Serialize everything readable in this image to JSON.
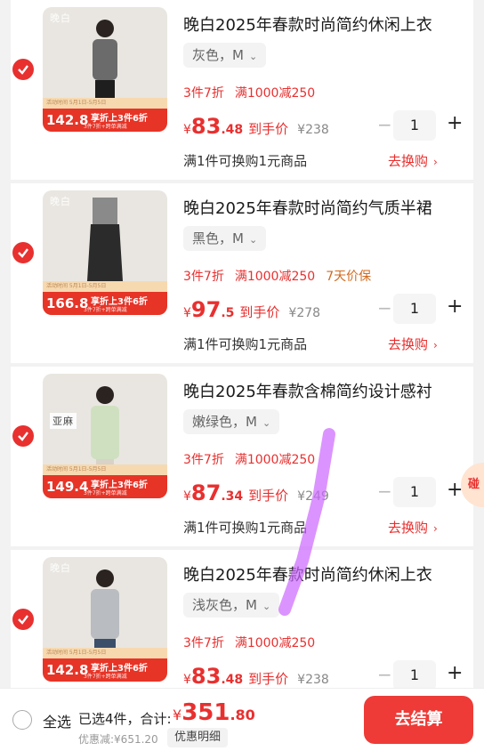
{
  "items": [
    {
      "title": "晚白2025年春款时尚简约休闲上衣",
      "sku": "灰色，M",
      "promos": [
        "3件7折",
        "满1000减250"
      ],
      "price_currency": "¥",
      "price_int": "83",
      "price_dec": ".48",
      "price_label": "到手价",
      "orig_price": "¥238",
      "quantity": "1",
      "exchange_text": "满1件可换购1元商品",
      "exchange_link": "去换购",
      "thumb_brand": "晚白",
      "thumb_price": "142.8",
      "thumb_tag": "享折上3件6折",
      "thumb_sub": "活动时间 5月1日-5月5日",
      "thumb_fine": "3件7折+跨单满减",
      "shirt_color": "#6b6b6b"
    },
    {
      "title": "晚白2025年春款时尚简约气质半裙",
      "sku": "黑色，M",
      "promos": [
        "3件7折",
        "满1000减250",
        "7天价保"
      ],
      "price_currency": "¥",
      "price_int": "97",
      "price_dec": ".5",
      "price_label": "到手价",
      "orig_price": "¥278",
      "quantity": "1",
      "exchange_text": "满1件可换购1元商品",
      "exchange_link": "去换购",
      "thumb_brand": "晚白",
      "thumb_price": "166.8",
      "thumb_tag": "享折上3件6折",
      "thumb_sub": "活动时间 5月1日-5月5日",
      "thumb_fine": "3件7折+跨单满减",
      "shirt_color": "#2b2b2b"
    },
    {
      "title": "晚白2025年春款含棉简约设计感衬",
      "sku": "嫩绿色，M",
      "promos": [
        "3件7折",
        "满1000减250"
      ],
      "price_currency": "¥",
      "price_int": "87",
      "price_dec": ".34",
      "price_label": "到手价",
      "orig_price": "¥249",
      "quantity": "1",
      "exchange_text": "满1件可换购1元商品",
      "exchange_link": "去换购",
      "thumb_brand": "亚麻",
      "thumb_price": "149.4",
      "thumb_tag": "享折上3件6折",
      "thumb_sub": "活动时间 5月1日-5月5日",
      "thumb_fine": "3件7折+跨单满减",
      "shirt_color": "#cfe0c0"
    },
    {
      "title": "晚白2025年春款时尚简约休闲上衣",
      "sku": "浅灰色，M",
      "promos": [
        "3件7折",
        "满1000减250"
      ],
      "price_currency": "¥",
      "price_int": "83",
      "price_dec": ".48",
      "price_label": "到手价",
      "orig_price": "¥238",
      "quantity": "1",
      "thumb_brand": "晚白",
      "thumb_price": "142.8",
      "thumb_tag": "享折上3件6折",
      "thumb_sub": "活动时间 5月1日-5月5日",
      "thumb_fine": "3件7折+跨单满减",
      "shirt_color": "#b9bcc0"
    }
  ],
  "footer": {
    "select_all": "全选",
    "selected_text": "已选4件，合计:",
    "total_currency": "¥",
    "total_int": "351",
    "total_dec": ".80",
    "discount_text": "优惠减:¥651.20",
    "detail_button": "优惠明细",
    "checkout_button": "去结算"
  },
  "floating_badge": "碰",
  "colors": {
    "accent": "#e8302f",
    "warranty": "#d2691e",
    "highlighter": "#cc66ff"
  }
}
